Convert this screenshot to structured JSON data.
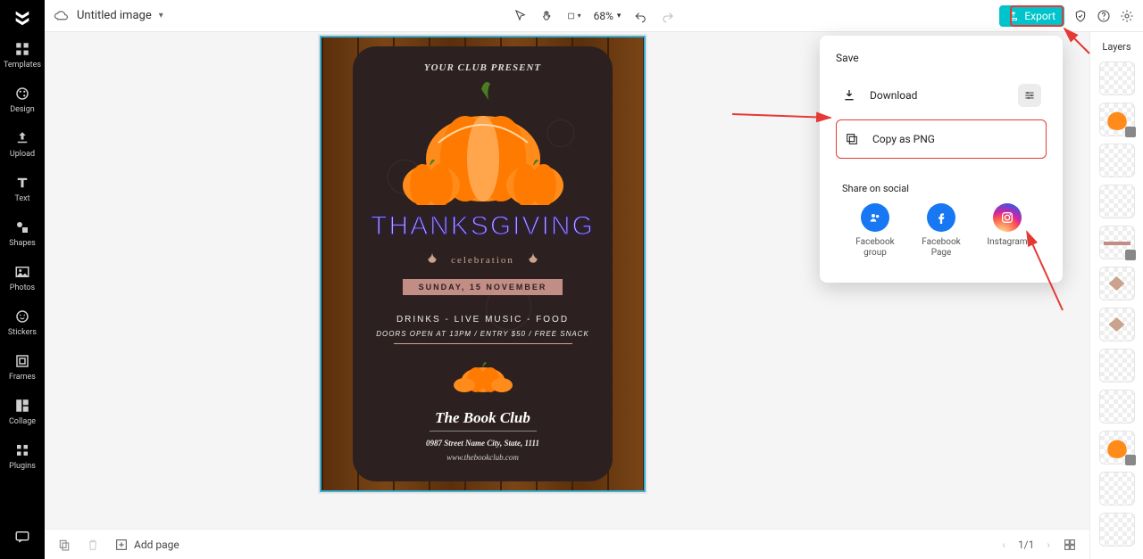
{
  "sidebar": {
    "items": [
      {
        "label": "Templates"
      },
      {
        "label": "Design"
      },
      {
        "label": "Upload"
      },
      {
        "label": "Text"
      },
      {
        "label": "Shapes"
      },
      {
        "label": "Photos"
      },
      {
        "label": "Stickers"
      },
      {
        "label": "Frames"
      },
      {
        "label": "Collage"
      },
      {
        "label": "Plugins"
      }
    ]
  },
  "topbar": {
    "title": "Untitled image",
    "zoom": "68%",
    "export_label": "Export"
  },
  "popover": {
    "save_heading": "Save",
    "download_label": "Download",
    "copy_png_label": "Copy as PNG",
    "share_heading": "Share on social",
    "share": [
      {
        "label": "Facebook group"
      },
      {
        "label": "Facebook Page"
      },
      {
        "label": "Instagram"
      }
    ]
  },
  "layers": {
    "heading": "Layers"
  },
  "bottombar": {
    "add_page": "Add page",
    "page_count": "1/1"
  },
  "flyer": {
    "present": "YOUR CLUB PRESENT",
    "title": "THANKSGIVING",
    "celebration": "celebration",
    "date": "SUNDAY, 15 NOVEMBER",
    "info1": "DRINKS - LIVE MUSIC - FOOD",
    "info2": "DOORS OPEN AT 13PM / ENTRY $50 / FREE SNACK",
    "club": "The Book Club",
    "address": "0987 Street Name City, State, 1111",
    "website": "www.thebookclub.com"
  }
}
